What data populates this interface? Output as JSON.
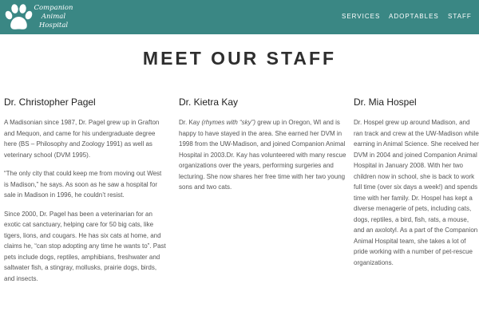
{
  "header": {
    "logo": {
      "line1": "Companion",
      "line2": "Animal",
      "line3": "Hospital"
    },
    "nav": [
      "SERVICES",
      "ADOPTABLES",
      "STAFF"
    ]
  },
  "page_title": "MEET OUR STAFF",
  "staff": [
    {
      "name": "Dr. Christopher Pagel",
      "paragraphs": [
        "A Madisonian since 1987, Dr. Pagel grew up in Grafton and Mequon, and came for his undergraduate degree here (BS – Philosophy and Zoology 1991) as well as veterinary school (DVM 1995).",
        "“The only city that could keep me from moving out West is Madison,” he says. As soon as he saw a hospital for sale in Madison in 1996, he couldn’t resist.",
        "Since 2000, Dr. Pagel has been a veterinarian for an exotic cat sanctuary, helping care for 50 big cats, like tigers, lions, and cougars. He has six cats at home, and claims he, “can stop adopting any time he wants to”. Past pets include dogs, reptiles, amphibians, freshwater and saltwater fish, a stingray, mollusks, prairie dogs, birds, and insects."
      ]
    },
    {
      "name": "Dr. Kietra Kay",
      "intro_a": "Dr. Kay ",
      "intro_em": "(rhymes with “sky”)",
      "intro_b": " grew up in Oregon, WI and is happy to have stayed in the area. She earned her DVM in 1998 from the UW-Madison, and joined Companion Animal Hospital in 2003.Dr. Kay has volunteered with many rescue organizations over the years, performing surgeries and lecturing. She now shares her free time with her two young sons and two cats."
    },
    {
      "name": "Dr. Mia Hospel",
      "paragraph": "Dr. Hospel grew up around Madison, and ran track and crew at the UW-Madison while earning in Animal Science. She received her DVM in 2004 and joined Companion Animal Hospital in January 2008. With her two children now in school, she is back to work full time (over six days a week!) and spends time with her family. Dr. Hospel has kept a diverse menagerie of pets, including cats, dogs, reptiles, a bird, fish, rats, a mouse, and an axolotyl. As a part of the Companion Animal Hospital team, she takes a lot of pride working with a number of pet-rescue organizations."
    }
  ]
}
